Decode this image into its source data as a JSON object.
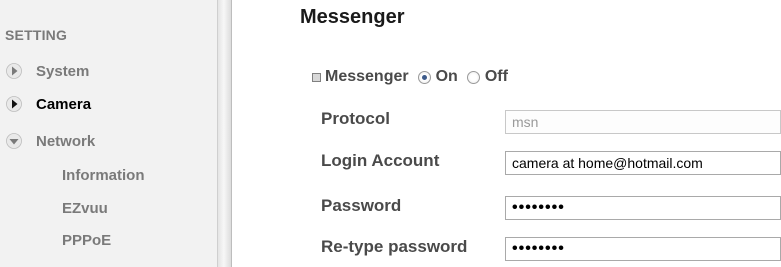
{
  "sidebar": {
    "title": "SETTING",
    "items": [
      {
        "label": "System",
        "icon": "arrow-right-icon",
        "active": false
      },
      {
        "label": "Camera",
        "icon": "arrow-right-icon",
        "active": true
      },
      {
        "label": "Network",
        "icon": "arrow-down-icon",
        "active": false
      }
    ],
    "subitems": [
      "Information",
      "EZvuu",
      "PPPoE"
    ]
  },
  "main": {
    "title": "Messenger",
    "messenger": {
      "label": "Messenger",
      "on_label": "On",
      "off_label": "Off",
      "selected": "On"
    },
    "form": {
      "protocol_label": "Protocol",
      "protocol_value": "msn",
      "login_label": "Login Account",
      "login_value": "camera at home@hotmail.com",
      "password_label": "Password",
      "password_value": "••••••••",
      "retype_label": "Re-type password",
      "retype_value": "••••••••"
    }
  },
  "colors": {
    "sidebar_bg": "#f2f2f2",
    "muted_text": "#7a7a7a",
    "active_text": "#000000",
    "radio_checked": "#3c5a8a"
  }
}
